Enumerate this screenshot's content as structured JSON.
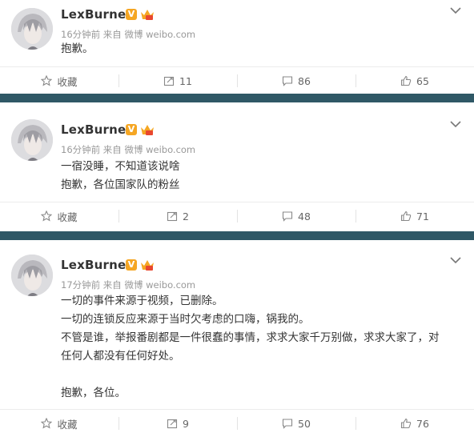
{
  "posts": [
    {
      "username": "LexBurner",
      "verified_badge": "V",
      "meta": "16分钟前 来自 微博 weibo.com",
      "lines": [
        "抱歉。"
      ],
      "actions": {
        "favorite": "收藏",
        "repost": "11",
        "comment": "86",
        "like": "65"
      }
    },
    {
      "username": "LexBurner",
      "verified_badge": "V",
      "meta": "16分钟前 来自 微博 weibo.com",
      "lines": [
        "一宿没睡，不知道该说啥",
        "抱歉，各位国家队的粉丝"
      ],
      "actions": {
        "favorite": "收藏",
        "repost": "2",
        "comment": "48",
        "like": "71"
      }
    },
    {
      "username": "LexBurner",
      "verified_badge": "V",
      "meta": "17分钟前 来自 微博 weibo.com",
      "lines": [
        "一切的事件来源于视频，已删除。",
        "一切的连锁反应来源于当时欠考虑的口嗨，锅我的。",
        "不管是谁，举报番剧都是一件很蠢的事情，求求大家千万别做，求求大家了，对",
        "任何人都没有任何好处。",
        "",
        "抱歉，各位。"
      ],
      "actions": {
        "favorite": "收藏",
        "repost": "9",
        "comment": "50",
        "like": "76"
      }
    }
  ],
  "colors": {
    "divider": "#2f5866",
    "badge": "#f5a623",
    "meta": "#999999",
    "text": "#333333"
  },
  "icons": [
    "avatar",
    "verified-v-icon",
    "vip-crown-icon",
    "chevron-down-icon",
    "star-icon",
    "repost-icon",
    "comment-icon",
    "like-icon"
  ]
}
